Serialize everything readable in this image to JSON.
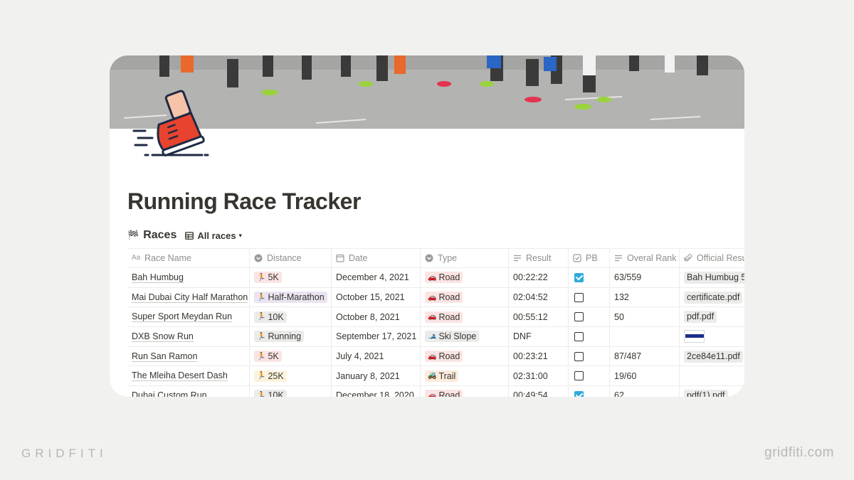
{
  "page": {
    "title": "Running Race Tracker"
  },
  "database": {
    "icon": "checkered-flag-icon",
    "icon_glyph": "🏁",
    "title": "Races",
    "view_label": "All races"
  },
  "columns": [
    {
      "label": "Race Name",
      "icon": "text-icon"
    },
    {
      "label": "Distance",
      "icon": "select-icon"
    },
    {
      "label": "Date",
      "icon": "calendar-icon"
    },
    {
      "label": "Type",
      "icon": "select-icon"
    },
    {
      "label": "Result",
      "icon": "text-lines-icon"
    },
    {
      "label": "PB",
      "icon": "checkbox-icon"
    },
    {
      "label": "Overal Rank",
      "icon": "text-lines-icon"
    },
    {
      "label": "Official Resu",
      "icon": "paperclip-icon"
    }
  ],
  "rows": [
    {
      "name": "Bah Humbug",
      "distance": "5K",
      "date": "December 4, 2021",
      "type": "Road",
      "result": "00:22:22",
      "pb": true,
      "rank": "63/559",
      "official": "Bah Humbug 5"
    },
    {
      "name": "Mai Dubai City Half Marathon",
      "distance": "Half-Marathon",
      "date": "October 15, 2021",
      "type": "Road",
      "result": "02:04:52",
      "pb": false,
      "rank": "132",
      "official": "certificate.pdf"
    },
    {
      "name": "Super Sport Meydan Run",
      "distance": "10K",
      "date": "October 8, 2021",
      "type": "Road",
      "result": "00:55:12",
      "pb": false,
      "rank": "50",
      "official": "pdf.pdf"
    },
    {
      "name": "DXB Snow Run",
      "distance": "Running",
      "date": "September 17, 2021",
      "type": "Ski Slope",
      "result": "DNF",
      "pb": false,
      "rank": "",
      "official": ""
    },
    {
      "name": "Run San Ramon",
      "distance": "5K",
      "date": "July 4, 2021",
      "type": "Road",
      "result": "00:23:21",
      "pb": false,
      "rank": "87/487",
      "official": "2ce84e11.pdf"
    },
    {
      "name": "The Mleiha Desert Dash",
      "distance": "25K",
      "date": "January 8, 2021",
      "type": "Trail",
      "result": "02:31:00",
      "pb": false,
      "rank": "19/60",
      "official": ""
    },
    {
      "name": "Dubai Custom Run",
      "distance": "10K",
      "date": "December 18, 2020",
      "type": "Road",
      "result": "00:49:54",
      "pb": true,
      "rank": "62",
      "official": "pdf(1).pdf"
    }
  ],
  "tag_colors": {
    "5K": "#fbe4e4",
    "Half-Marathon": "#eae4f2",
    "10K": "#ebebea",
    "Running": "#ebebea",
    "25K": "#fbf3db",
    "Road": "#fbe4e4",
    "Ski Slope": "#ebebea",
    "Trail": "#faebdd"
  },
  "tag_emoji": {
    "distance": "🏃",
    "Road": "🚗",
    "Ski Slope": "🎿",
    "Trail": "🚜"
  },
  "branding": {
    "left": "GRIDFITI",
    "right": "gridfiti.com"
  }
}
